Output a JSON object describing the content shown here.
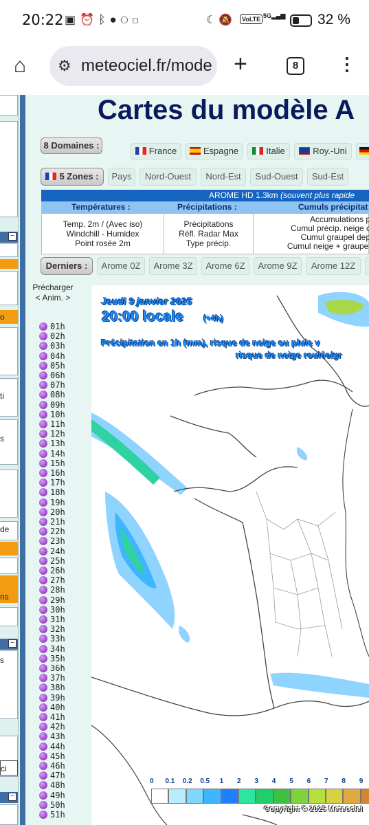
{
  "status_bar": {
    "time": "20:22",
    "battery_percent": "32 %",
    "battery_level": 0.32,
    "network_label": "VoLTE",
    "signal_label": "5G",
    "left_icons": [
      "n-icon",
      "alarm-icon",
      "bluetooth-icon",
      "chat-icon",
      "whatsapp-icon",
      "instagram-icon"
    ],
    "right_icons": [
      "moon-icon",
      "mute-icon",
      "volte-icon",
      "signal-icon",
      "battery-icon"
    ]
  },
  "browser": {
    "url": "meteociel.fr/mode",
    "tab_count": "8"
  },
  "page": {
    "title": "Cartes du modèle A",
    "domains_label": "8 Domaines :",
    "domains": [
      {
        "label": "France",
        "flag": "fr"
      },
      {
        "label": "Espagne",
        "flag": "es"
      },
      {
        "label": "Italie",
        "flag": "it"
      },
      {
        "label": "Roy.-Uni",
        "flag": "uk"
      }
    ],
    "zones_label": "5 Zones :",
    "zones": [
      "Pays",
      "Nord-Ouest",
      "Nord-Est",
      "Sud-Ouest",
      "Sud-Est"
    ],
    "arome_header": "AROME HD 1.3km",
    "arome_header_note": "(souvent plus rapide",
    "col_headers": [
      "Températures :",
      "Précipitations :",
      "Cumuls précipitat"
    ],
    "col_temps": [
      "Temp. 2m / (Avec iso)",
      "Windchill - Humidex",
      "Point rosée 2m"
    ],
    "col_precip": [
      "Précipitations",
      "Réfl. Radar Max",
      "Type précip."
    ],
    "col_cumuls": [
      "Accumulations p",
      "Cumul précip. neige c",
      "Cumul graupel dep",
      "Cumul neige + graupel"
    ],
    "derniers_label": "Derniers :",
    "runs": [
      "Arome 0Z",
      "Arome 3Z",
      "Arome 6Z",
      "Arome 9Z",
      "Arome 12Z"
    ],
    "precharger": "Précharger",
    "anim": "< Anim. >",
    "hours": [
      "01h",
      "02h",
      "03h",
      "04h",
      "05h",
      "06h",
      "07h",
      "08h",
      "09h",
      "10h",
      "11h",
      "12h",
      "13h",
      "14h",
      "15h",
      "16h",
      "17h",
      "18h",
      "19h",
      "20h",
      "21h",
      "22h",
      "23h",
      "24h",
      "25h",
      "26h",
      "27h",
      "28h",
      "29h",
      "30h",
      "31h",
      "32h",
      "33h",
      "34h",
      "35h",
      "36h",
      "37h",
      "38h",
      "39h",
      "40h",
      "41h",
      "42h",
      "43h",
      "44h",
      "45h",
      "46h",
      "47h",
      "48h",
      "49h",
      "50h",
      "51h"
    ],
    "left_fragments": [
      "o",
      "ti",
      "s",
      "de",
      "ns",
      "s",
      "ci"
    ]
  },
  "map": {
    "date": "Jeudi 9 janvier 2025",
    "time": "20:00 locale",
    "offset": "(+4h)",
    "desc1": "Précipitation en 1h (mm), risque de neige ou pluie v",
    "desc2": "risque de neige roulée/gr",
    "legend_ticks": [
      "0",
      "0.1",
      "0.2",
      "0.5",
      "1",
      "2",
      "3",
      "4",
      "5",
      "6",
      "7",
      "8",
      "9"
    ],
    "legend_colors": [
      "#ffffff",
      "#b9ecff",
      "#7fd6ff",
      "#3fb4ff",
      "#1e7fff",
      "#2ee5a0",
      "#1fcf6a",
      "#3fbf3f",
      "#7fd33f",
      "#b5df3f",
      "#d6d13f",
      "#dfa93f",
      "#d5852f"
    ],
    "copyright": "Copyright © 2025 MeteocieI"
  }
}
